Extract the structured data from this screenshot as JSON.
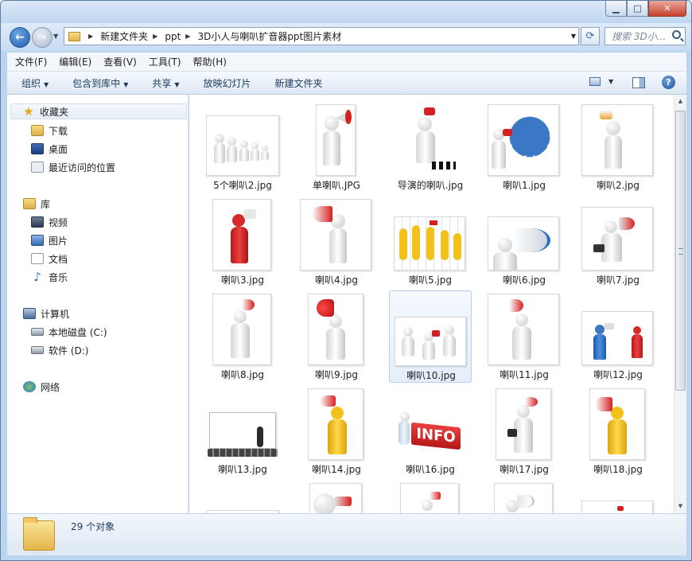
{
  "window": {
    "minimize": "▁",
    "maximize": "□",
    "close": "✕"
  },
  "address": {
    "crumbs": [
      "新建文件夹",
      "ppt",
      "3D小人与喇叭扩音器ppt图片素材"
    ],
    "search_placeholder": "搜索 3D小..."
  },
  "menu": [
    "文件(F)",
    "编辑(E)",
    "查看(V)",
    "工具(T)",
    "帮助(H)"
  ],
  "toolbar": {
    "organize": "组织",
    "include_in_library": "包含到库中",
    "share": "共享",
    "slideshow": "放映幻灯片",
    "new_folder": "新建文件夹"
  },
  "nav": {
    "favorites": "收藏夹",
    "downloads": "下载",
    "desktop": "桌面",
    "recent": "最近访问的位置",
    "libraries": "库",
    "videos": "视频",
    "pictures": "图片",
    "documents": "文档",
    "music": "音乐",
    "computer": "计算机",
    "drive_c": "本地磁盘 (C:)",
    "drive_d": "软件 (D:)",
    "network": "网络"
  },
  "files": [
    "5个喇叭2.jpg",
    "单喇叭.JPG",
    "导演的喇叭.jpg",
    "喇叭1.jpg",
    "喇叭2.jpg",
    "喇叭3.jpg",
    "喇叭4.jpg",
    "喇叭5.jpg",
    "喇叭6.jpg",
    "喇叭7.jpg",
    "喇叭8.jpg",
    "喇叭9.jpg",
    "喇叭10.jpg",
    "喇叭11.jpg",
    "喇叭12.jpg",
    "喇叭13.jpg",
    "喇叭14.jpg",
    "喇叭16.jpg",
    "喇叭17.jpg",
    "喇叭18.jpg"
  ],
  "selected_file": "喇叭10.jpg",
  "status": {
    "count_text": "29 个对象"
  },
  "colors": {
    "accent_blue": "#3a6ea5",
    "megaphone_red": "#d42020",
    "figure_yellow": "#f2c21b",
    "selection": "#e4eefa"
  }
}
